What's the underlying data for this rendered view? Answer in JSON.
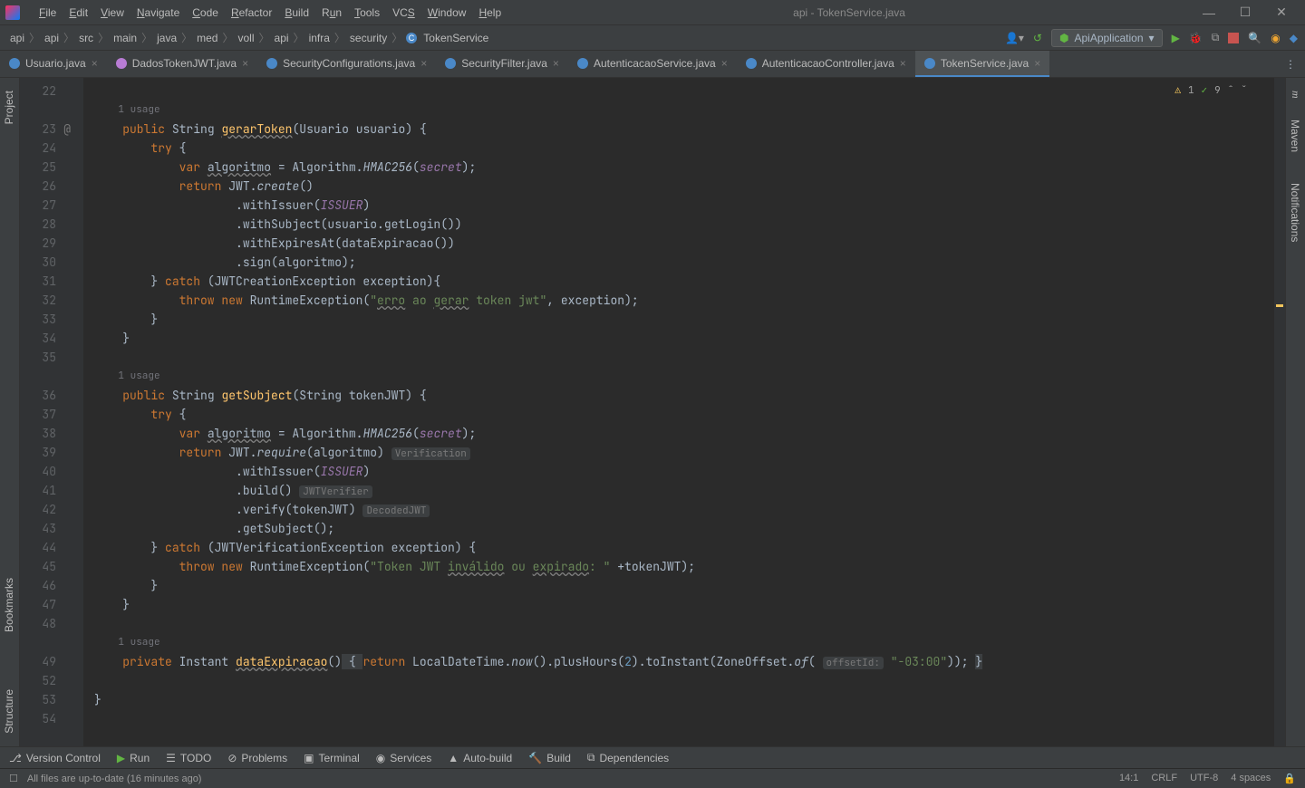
{
  "window_title": "api - TokenService.java",
  "menu": [
    "File",
    "Edit",
    "View",
    "Navigate",
    "Code",
    "Refactor",
    "Build",
    "Run",
    "Tools",
    "VCS",
    "Window",
    "Help"
  ],
  "breadcrumbs": [
    "api",
    "api",
    "src",
    "main",
    "java",
    "med",
    "voll",
    "api",
    "infra",
    "security",
    "TokenService"
  ],
  "run_config": "ApiApplication",
  "tabs": [
    {
      "label": "Usuario.java"
    },
    {
      "label": "DadosTokenJWT.java"
    },
    {
      "label": "SecurityConfigurations.java"
    },
    {
      "label": "SecurityFilter.java"
    },
    {
      "label": "AutenticacaoService.java"
    },
    {
      "label": "AutenticacaoController.java"
    },
    {
      "label": "TokenService.java",
      "active": true
    }
  ],
  "left_tabs": {
    "project": "Project",
    "bookmarks": "Bookmarks",
    "structure": "Structure"
  },
  "right_tabs": {
    "maven": "Maven",
    "notifications": "Notifications"
  },
  "inspections": {
    "warn": "1",
    "weak": "9"
  },
  "usage": "1 usage",
  "toolwindows": [
    {
      "icon": "branch",
      "label": "Version Control"
    },
    {
      "icon": "play",
      "label": "Run"
    },
    {
      "icon": "todo",
      "label": "TODO"
    },
    {
      "icon": "problems",
      "label": "Problems"
    },
    {
      "icon": "terminal",
      "label": "Terminal"
    },
    {
      "icon": "services",
      "label": "Services"
    },
    {
      "icon": "auto",
      "label": "Auto-build"
    },
    {
      "icon": "hammer",
      "label": "Build"
    },
    {
      "icon": "deps",
      "label": "Dependencies"
    }
  ],
  "statusbar": {
    "message": "All files are up-to-date (16 minutes ago)",
    "pos": "14:1",
    "eol": "CRLF",
    "enc": "UTF-8",
    "indent": "4 spaces"
  },
  "lines": [
    "22",
    "23",
    "24",
    "25",
    "26",
    "27",
    "28",
    "29",
    "30",
    "31",
    "32",
    "33",
    "34",
    "35",
    "",
    "36",
    "37",
    "38",
    "39",
    "40",
    "41",
    "42",
    "43",
    "44",
    "45",
    "46",
    "47",
    "48",
    "",
    "49",
    "52",
    "53",
    "54"
  ],
  "code": {
    "l23_public": "public",
    "l23_string": "String",
    "l23_method": "gerarToken",
    "l23_pa": "(",
    "l23_type": "Usuario",
    "l23_param": "usuario",
    "l23_tail": ") {",
    "l24_try": "try",
    "l24_b": " {",
    "l25_var": "var",
    "l25_sp1": " ",
    "l25_alg": "algoritmo",
    "l25_eq": " = Algorithm.",
    "l25_hmac": "HMAC256",
    "l25_po": "(",
    "l25_secret": "secret",
    "l25_pc": ");",
    "l26_return": "return",
    "l26_jwt": " JWT.",
    "l26_create": "create",
    "l26_tail": "()",
    "l27_w": ".withIssuer(",
    "l27_issuer": "ISSUER",
    "l27_tail": ")",
    "l28_w": ".withSubject(",
    "l28_get": "usuario",
    "l28_m": ".getLogin())",
    "l29_w": ".withExpiresAt(dataExpiracao())",
    "l30_w": ".sign(",
    "l30_a": "algoritmo",
    "l30_tail": ");",
    "l31_catch": "catch",
    "l31_a": " (JWTCreationException exception){",
    "l32_throw": "throw new",
    "l32_ex": " RuntimeException(",
    "l32_s1": "\"",
    "l32_erro": "erro",
    "l32_ao": " ao ",
    "l32_gerar": "gerar",
    "l32_rest": " token jwt\"",
    "l32_tail": ", exception);",
    "l33_b": "}",
    "l34_b": "}",
    "l36_public": "public",
    "l36_string": "String",
    "l36_method": "getSubject",
    "l36_pa": "(String ",
    "l36_param": "tokenJWT",
    "l36_tail": ") {",
    "l37_try": "try",
    "l37_b": " {",
    "l38_var": "var",
    "l38_sp": " ",
    "l38_alg": "algoritmo",
    "l38_eq": " = Algorithm.",
    "l38_hmac": "HMAC256",
    "l38_po": "(",
    "l38_secret": "secret",
    "l38_pc": ");",
    "l39_return": "return",
    "l39_jwt": " JWT.",
    "l39_req": "require",
    "l39_po": "(",
    "l39_a": "algoritmo",
    "l39_pc": ")",
    "l39_hint": "Verification",
    "l40_w": ".withIssuer(",
    "l40_issuer": "ISSUER",
    "l40_tail": ")",
    "l41_w": ".build()",
    "l41_hint": "JWTVerifier",
    "l42_w": ".verify(",
    "l42_a": "tokenJWT",
    "l42_pc": ")",
    "l42_hint": "DecodedJWT",
    "l43_w": ".getSubject();",
    "l44_catch": "catch",
    "l44_a": " (JWTVerificationException exception) {",
    "l45_throw": "throw new",
    "l45_ex": " RuntimeException(",
    "l45_s1": "\"Token JWT ",
    "l45_inv": "inválido",
    "l45_ou": " ou ",
    "l45_exp": "expirado",
    "l45_rest": ": \"",
    "l45_tail": " +tokenJWT);",
    "l46_b": "}",
    "l47_b": "}",
    "l49_private": "private",
    "l49_instant": " Instant ",
    "l49_method": "dataExpiracao",
    "l49_par": "()",
    "l49_b": " { ",
    "l49_return": "return",
    "l49_ldt": " LocalDateTime.",
    "l49_now": "now",
    "l49_ph": "().plusHours(",
    "l49_2": "2",
    "l49_ti": ").toInstant(ZoneOffset.",
    "l49_of": "of",
    "l49_po": "( ",
    "l49_hint": "offsetId:",
    "l49_str": "\"-03:00\"",
    "l49_tail": ")); ",
    "l49_cb": "}",
    "l53_b": "}"
  }
}
